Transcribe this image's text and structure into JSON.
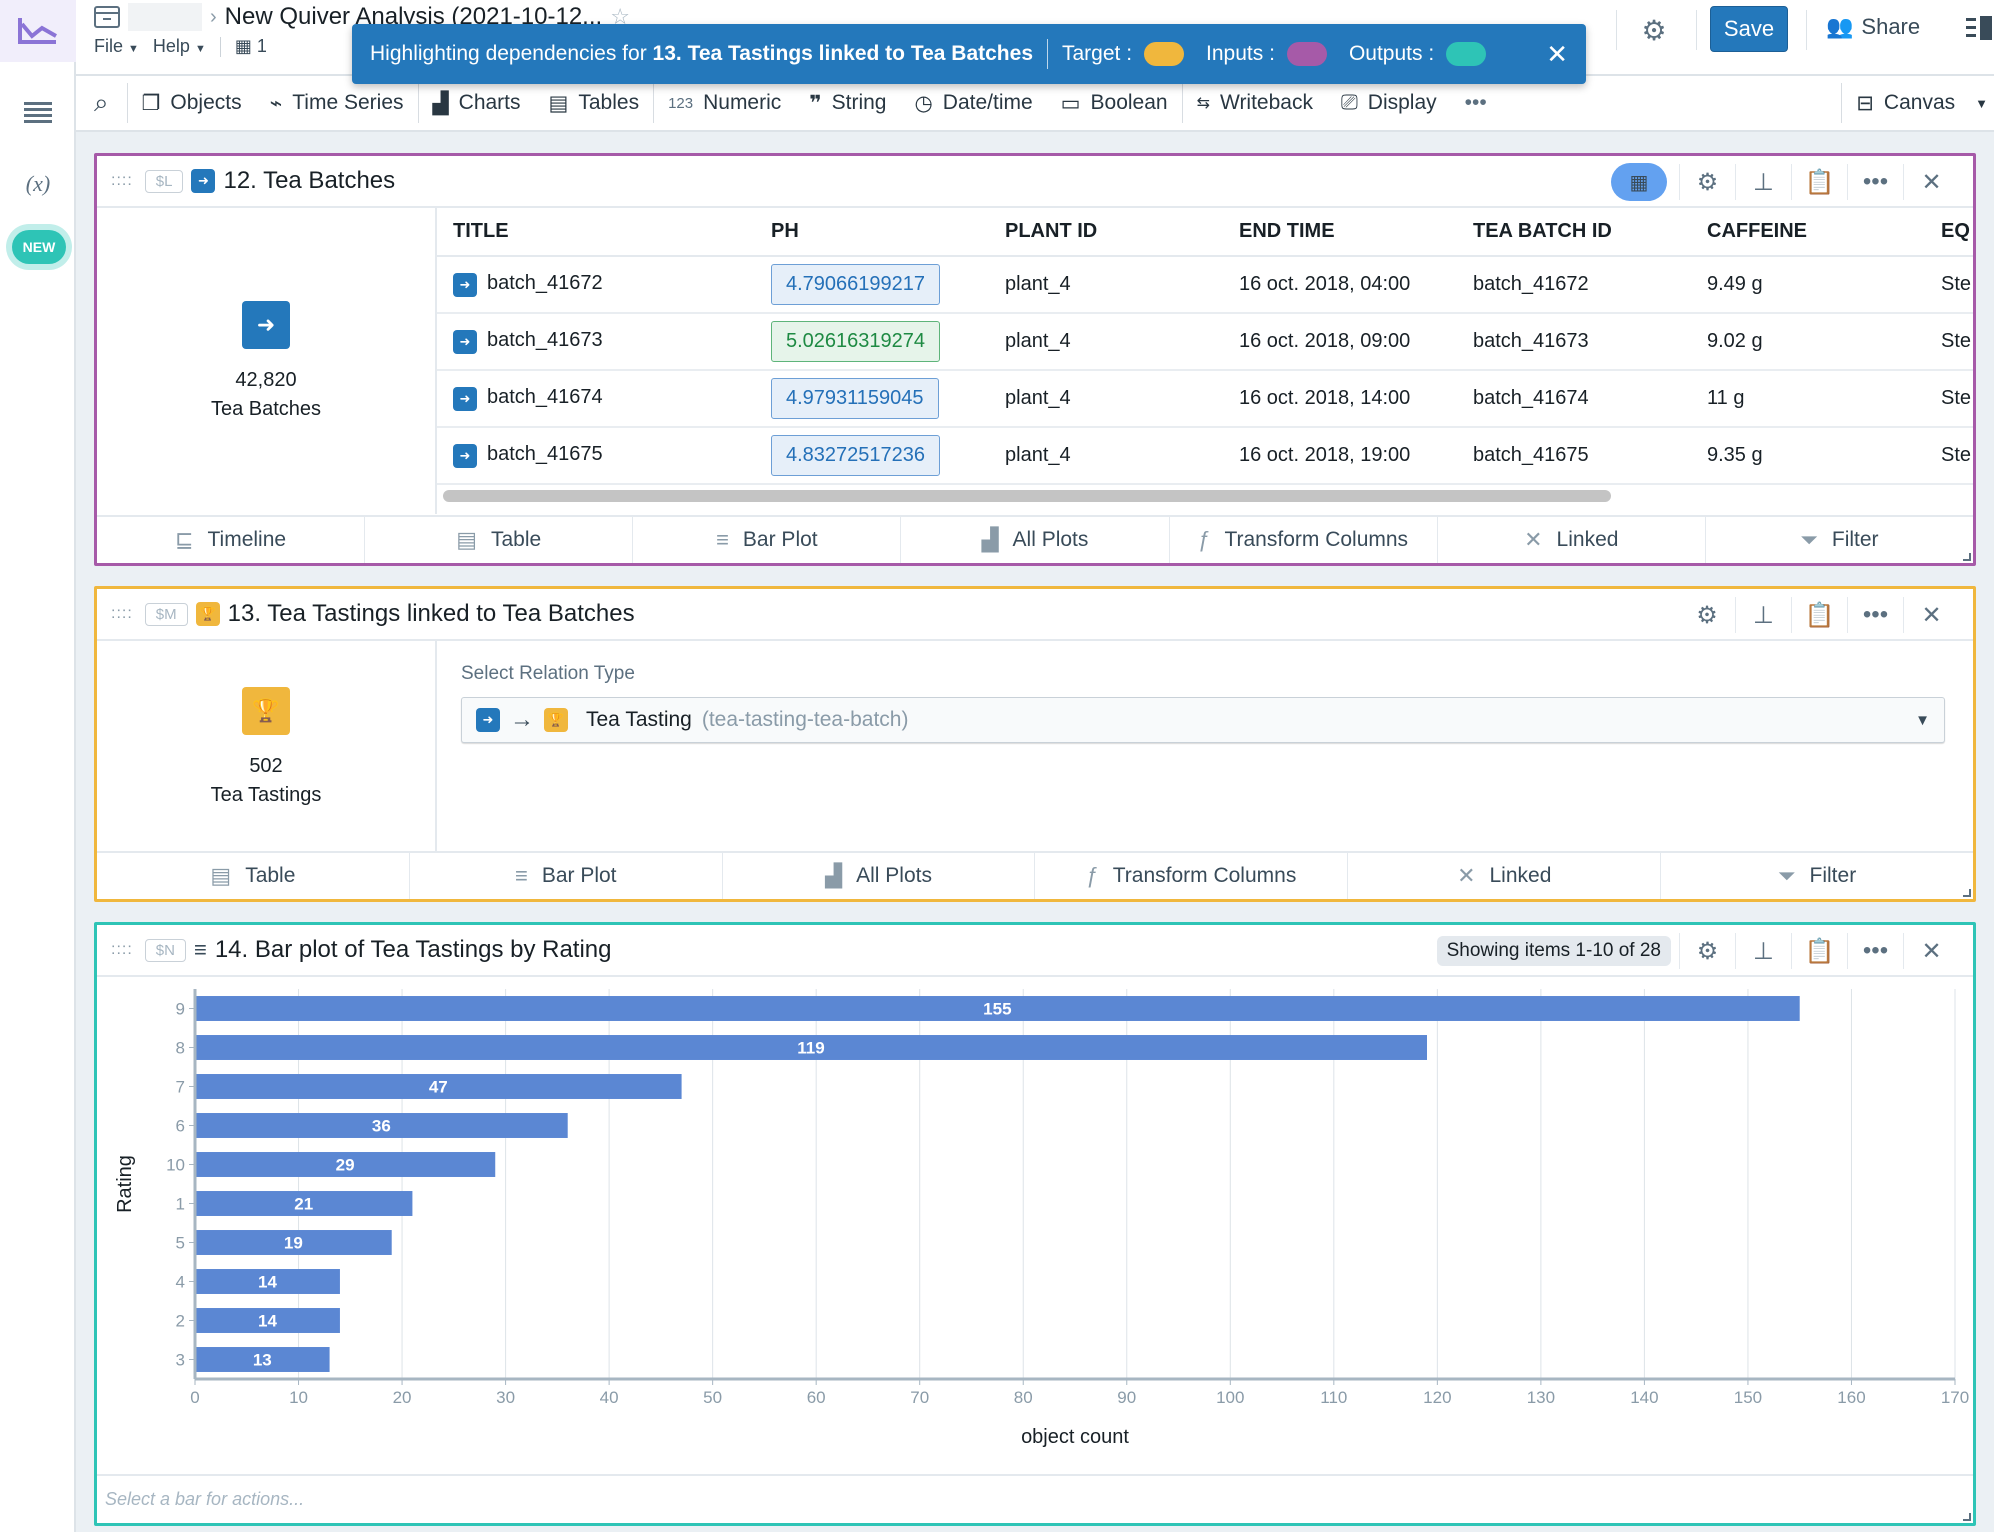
{
  "app": {
    "title": "New Quiver Analysis (2021-10-12...",
    "menus": {
      "file": "File",
      "help": "Help",
      "count": "1"
    },
    "save_label": "Save",
    "share_label": "Share"
  },
  "sidebar": {
    "items": [
      {
        "icon": "menu-icon"
      },
      {
        "icon": "variables-icon",
        "label": "(x)"
      },
      {
        "label": "NEW"
      }
    ]
  },
  "toolbar": {
    "items": [
      {
        "label": "Objects",
        "icon": "objects-icon"
      },
      {
        "label": "Time Series",
        "icon": "timeseries-icon"
      },
      {
        "label": "Charts",
        "icon": "charts-icon"
      },
      {
        "label": "Tables",
        "icon": "tables-icon"
      },
      {
        "label": "Numeric",
        "icon": "numeric-icon",
        "prefix": "123"
      },
      {
        "label": "String",
        "icon": "string-icon"
      },
      {
        "label": "Date/time",
        "icon": "clock-icon"
      },
      {
        "label": "Boolean",
        "icon": "boolean-icon"
      },
      {
        "label": "Writeback",
        "icon": "writeback-icon"
      },
      {
        "label": "Display",
        "icon": "display-icon"
      }
    ],
    "more": "•••",
    "canvas_label": "Canvas"
  },
  "banner": {
    "prefix": "Highlighting dependencies for",
    "target_name": "13. Tea Tastings linked to Tea Batches",
    "target_label": "Target :",
    "inputs_label": "Inputs :",
    "outputs_label": "Outputs :",
    "colors": {
      "target": "#f0b73d",
      "inputs": "#a65aa8",
      "outputs": "#2ec4b6"
    }
  },
  "panels": {
    "batches": {
      "tag": "$L",
      "title": "12. Tea Batches",
      "border_color": "#a65aa8",
      "count": "42,820",
      "count_label": "Tea Batches",
      "columns": [
        "TITLE",
        "PH",
        "PLANT ID",
        "END TIME",
        "TEA BATCH ID",
        "CAFFEINE",
        "EQ"
      ],
      "rows": [
        {
          "title": "batch_41672",
          "ph": "4.79066199217",
          "ph_state": "blue",
          "plant": "plant_4",
          "end": "16 oct. 2018, 04:00",
          "id": "batch_41672",
          "caffeine": "9.49 g",
          "eq": "Ste"
        },
        {
          "title": "batch_41673",
          "ph": "5.02616319274",
          "ph_state": "green",
          "plant": "plant_4",
          "end": "16 oct. 2018, 09:00",
          "id": "batch_41673",
          "caffeine": "9.02 g",
          "eq": "Ste"
        },
        {
          "title": "batch_41674",
          "ph": "4.97931159045",
          "ph_state": "blue",
          "plant": "plant_4",
          "end": "16 oct. 2018, 14:00",
          "id": "batch_41674",
          "caffeine": "11 g",
          "eq": "Ste"
        },
        {
          "title": "batch_41675",
          "ph": "4.83272517236",
          "ph_state": "blue",
          "plant": "plant_4",
          "end": "16 oct. 2018, 19:00",
          "id": "batch_41675",
          "caffeine": "9.35 g",
          "eq": "Ste"
        }
      ],
      "footer": [
        "Timeline",
        "Table",
        "Bar Plot",
        "All Plots",
        "Transform Columns",
        "Linked",
        "Filter"
      ]
    },
    "tastings": {
      "tag": "$M",
      "title": "13. Tea Tastings linked to Tea Batches",
      "border_color": "#f0b73d",
      "count": "502",
      "count_label": "Tea Tastings",
      "relation_label": "Select Relation Type",
      "relation_value": "Tea Tasting",
      "relation_id": "(tea-tasting-tea-batch)",
      "footer": [
        "Table",
        "Bar Plot",
        "All Plots",
        "Transform Columns",
        "Linked",
        "Filter"
      ]
    },
    "barplot": {
      "tag": "$N",
      "title": "14. Bar plot of Tea Tastings by Rating",
      "border_color": "#2ec4b6",
      "showing": "Showing items 1-10 of 28",
      "footer_hint": "Select a bar for actions..."
    }
  },
  "chart_data": {
    "type": "bar",
    "orientation": "horizontal",
    "title": "14. Bar plot of Tea Tastings by Rating",
    "categories": [
      "9",
      "8",
      "7",
      "6",
      "10",
      "1",
      "5",
      "4",
      "2",
      "3"
    ],
    "values": [
      155,
      119,
      47,
      36,
      29,
      21,
      19,
      14,
      14,
      13
    ],
    "xlabel": "object count",
    "ylabel": "Rating",
    "xlim": [
      0,
      170
    ],
    "xticks": [
      0,
      10,
      20,
      30,
      40,
      50,
      60,
      70,
      80,
      90,
      100,
      110,
      120,
      130,
      140,
      150,
      160,
      170
    ],
    "grid": true,
    "bar_color": "#5b87d3"
  }
}
